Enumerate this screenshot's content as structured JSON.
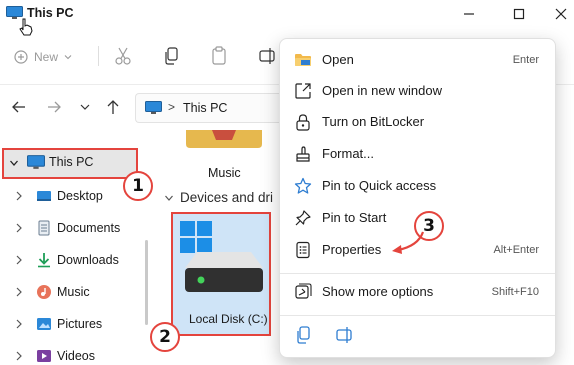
{
  "window": {
    "title": "This PC",
    "icon": "monitor-icon",
    "controls": [
      "minimize-icon",
      "maximize-icon",
      "close-icon"
    ]
  },
  "commandbar": {
    "new_label": "New",
    "icons": [
      "cut-icon",
      "copy-icon",
      "paste-icon",
      "rename-icon"
    ]
  },
  "address": {
    "back": "arrow-left-icon",
    "forward": "arrow-right-icon",
    "recent": "chevron-down-icon",
    "up": "arrow-up-icon",
    "crumb_sep": ">",
    "crumb": "This PC"
  },
  "sidebar": {
    "items": [
      {
        "label": "This PC",
        "icon": "monitor-icon",
        "expanded": true
      },
      {
        "label": "Desktop",
        "icon": "desktop-folder-icon"
      },
      {
        "label": "Documents",
        "icon": "documents-icon"
      },
      {
        "label": "Downloads",
        "icon": "download-icon"
      },
      {
        "label": "Music",
        "icon": "music-icon"
      },
      {
        "label": "Pictures",
        "icon": "pictures-icon"
      },
      {
        "label": "Videos",
        "icon": "videos-icon"
      }
    ]
  },
  "main": {
    "music_label": "Music",
    "group_label": "Devices and dri",
    "disk_label": "Local Disk (C:)"
  },
  "context_menu": {
    "items": [
      {
        "label": "Open",
        "shortcut": "Enter",
        "icon": "folder-open-icon"
      },
      {
        "label": "Open in new window",
        "shortcut": "",
        "icon": "open-new-window-icon"
      },
      {
        "label": "Turn on BitLocker",
        "shortcut": "",
        "icon": "lock-icon"
      },
      {
        "label": "Format...",
        "shortcut": "",
        "icon": "format-brush-icon"
      },
      {
        "label": "Pin to Quick access",
        "shortcut": "",
        "icon": "star-icon"
      },
      {
        "label": "Pin to Start",
        "shortcut": "",
        "icon": "pin-icon"
      },
      {
        "label": "Properties",
        "shortcut": "Alt+Enter",
        "icon": "properties-icon"
      },
      {
        "label": "Show more options",
        "shortcut": "Shift+F10",
        "icon": "more-options-icon"
      }
    ],
    "bottom_icons": [
      "copy-icon",
      "rename-icon"
    ]
  },
  "callouts": [
    "1",
    "2",
    "3"
  ],
  "colors": {
    "highlight_border": "#e4443d",
    "tile_selected": "#cfe4f7",
    "accent": "#0067c0"
  }
}
